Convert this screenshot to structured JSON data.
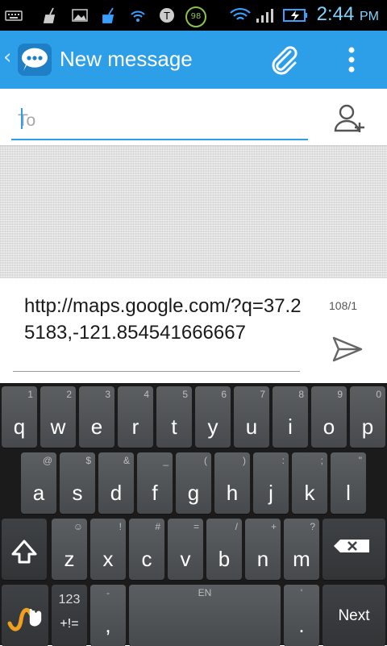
{
  "status_bar": {
    "time": "2:44",
    "ampm": "PM",
    "battery_badge": "98",
    "icons": [
      "keyboard-icon",
      "broom-icon",
      "image-icon",
      "cleaner-icon",
      "wifi-call-icon",
      "tmobile-icon",
      "battery-saver-icon",
      "wifi-icon",
      "signal-icon",
      "battery-charging-icon"
    ]
  },
  "action_bar": {
    "title": "New message",
    "icons": [
      "back-chevron-icon",
      "messaging-app-icon",
      "attach-paperclip-icon",
      "overflow-menu-icon"
    ]
  },
  "recipient": {
    "placeholder": "To",
    "value": "",
    "add_contact_icon": "add-person-icon"
  },
  "compose": {
    "message": "http://maps.google.com/?q=37.25183,-121.854541666667",
    "counter": "108/1",
    "send_icon": "send-icon"
  },
  "keyboard": {
    "row1": [
      {
        "k": "q",
        "h": "1"
      },
      {
        "k": "w",
        "h": "2"
      },
      {
        "k": "e",
        "h": "3"
      },
      {
        "k": "r",
        "h": "4"
      },
      {
        "k": "t",
        "h": "5"
      },
      {
        "k": "y",
        "h": "6"
      },
      {
        "k": "u",
        "h": "7"
      },
      {
        "k": "i",
        "h": "8"
      },
      {
        "k": "o",
        "h": "9"
      },
      {
        "k": "p",
        "h": "0"
      }
    ],
    "row2": [
      {
        "k": "a",
        "h": "@"
      },
      {
        "k": "s",
        "h": "$"
      },
      {
        "k": "d",
        "h": "&"
      },
      {
        "k": "f",
        "h": "_"
      },
      {
        "k": "g",
        "h": "("
      },
      {
        "k": "h",
        "h": ")"
      },
      {
        "k": "j",
        "h": ":"
      },
      {
        "k": "k",
        "h": ";"
      },
      {
        "k": "l",
        "h": "\""
      }
    ],
    "row3": [
      {
        "k": "z",
        "h": "☺"
      },
      {
        "k": "x",
        "h": "!"
      },
      {
        "k": "c",
        "h": "#"
      },
      {
        "k": "v",
        "h": "="
      },
      {
        "k": "b",
        "h": "/"
      },
      {
        "k": "n",
        "h": "+"
      },
      {
        "k": "m",
        "h": "?"
      }
    ],
    "row4": {
      "symbols_top": "123",
      "symbols_bottom": "+!=",
      "comma": ",",
      "comma_hint": "-",
      "space_hint": "EN",
      "period": ".",
      "period_hint": "'",
      "action": "Next"
    },
    "accent_color": "#2c9fe8",
    "swype_color": "#f0a01f"
  }
}
